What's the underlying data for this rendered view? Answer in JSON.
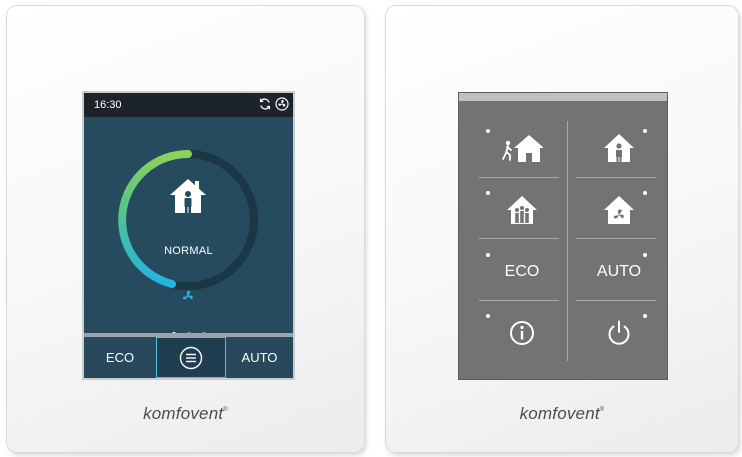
{
  "left_controller": {
    "status_bar": {
      "time": "16:30"
    },
    "mode": {
      "label": "NORMAL"
    },
    "pager": {
      "pages": 3,
      "active": 1
    },
    "bottom_bar": {
      "eco_label": "ECO",
      "auto_label": "AUTO"
    },
    "brand": "komfovent",
    "brand_mark": "®"
  },
  "right_controller": {
    "buttons": {
      "eco_label": "ECO",
      "auto_label": "AUTO"
    },
    "brand": "komfovent",
    "brand_mark": "®"
  },
  "colors": {
    "screen_background": "#264a5e",
    "status_bar": "#1c2329",
    "arc_gradient_start": "#8bd45a",
    "arc_gradient_end": "#24b3e0",
    "accent_border": "#4ec3e0",
    "keypad_background": "#737373"
  },
  "icons": {
    "status_sync": "refresh-icon",
    "status_fan": "fan-icon",
    "mode": "house-person-icon",
    "fan_speed": "fan-icon",
    "menu": "menu-icon"
  }
}
